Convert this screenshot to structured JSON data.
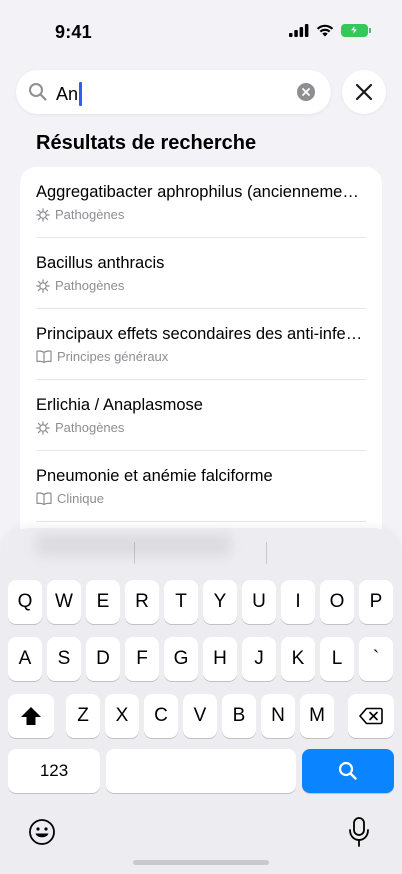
{
  "status_bar": {
    "time": "9:41",
    "icons": [
      "cellular-signal-icon",
      "wifi-icon",
      "battery-charging-icon"
    ],
    "battery_color": "#34c759"
  },
  "search": {
    "value": "An",
    "placeholder": "",
    "icons": [
      "search-icon",
      "clear-icon",
      "close-icon"
    ]
  },
  "results": {
    "heading": "Résultats de recherche",
    "items": [
      {
        "title": "Aggregatibacter aphrophilus (ancienneme…",
        "category": "Pathogènes",
        "icon": "virus-icon"
      },
      {
        "title": "Bacillus anthracis",
        "category": "Pathogènes",
        "icon": "virus-icon"
      },
      {
        "title": "Principaux effets secondaires des anti-infe…",
        "category": "Principes généraux",
        "icon": "book-icon"
      },
      {
        "title": "Erlichia / Anaplasmose",
        "category": "Pathogènes",
        "icon": "virus-icon"
      },
      {
        "title": "Pneumonie et anémie falciforme",
        "category": "Clinique",
        "icon": "book-icon"
      }
    ]
  },
  "keyboard": {
    "row1": [
      "Q",
      "W",
      "E",
      "R",
      "T",
      "Y",
      "U",
      "I",
      "O",
      "P"
    ],
    "row2": [
      "A",
      "S",
      "D",
      "F",
      "G",
      "H",
      "J",
      "K",
      "L",
      "`"
    ],
    "row3": [
      "Z",
      "X",
      "C",
      "V",
      "B",
      "N",
      "M"
    ],
    "numbers_label": "123",
    "space_label": "",
    "accent_color": "#0a84ff",
    "icons": [
      "shift-icon",
      "backspace-icon",
      "search-icon",
      "emoji-icon",
      "microphone-icon"
    ]
  }
}
